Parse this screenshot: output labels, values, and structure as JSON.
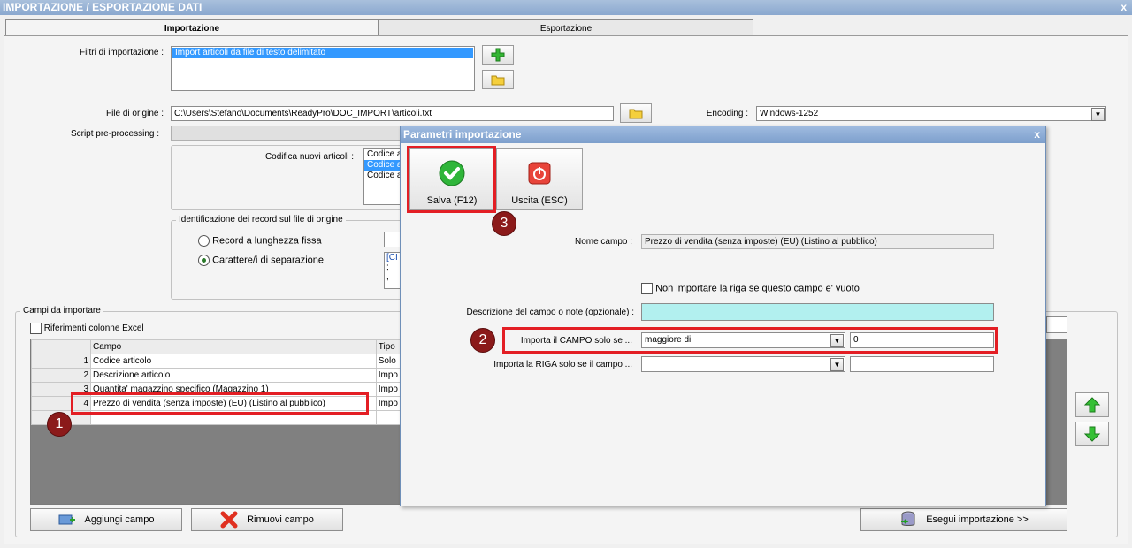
{
  "window": {
    "title": "IMPORTAZIONE / ESPORTAZIONE DATI",
    "close": "x"
  },
  "tabs": [
    {
      "label": "Importazione"
    },
    {
      "label": "Esportazione"
    }
  ],
  "filters": {
    "label": "Filtri di importazione :",
    "items": [
      "Import articoli da file di testo delimitato"
    ]
  },
  "origin": {
    "label": "File di origine :",
    "value": "C:\\Users\\Stefano\\Documents\\ReadyPro\\DOC_IMPORT\\articoli.txt"
  },
  "encoding": {
    "label": "Encoding :",
    "value": "Windows-1252"
  },
  "script": {
    "label": "Script pre-processing :"
  },
  "codifica": {
    "label": "Codifica nuovi articoli :",
    "items": [
      "Codice a",
      "Codice a",
      "Codice a"
    ]
  },
  "identificazione": {
    "title": "Identificazione dei record sul file di origine",
    "option1": "Record a lunghezza fissa",
    "option2": "Carattere/i di separazione",
    "sep_lines": [
      "[CI",
      ";",
      ","
    ]
  },
  "campi": {
    "title": "Campi da importare",
    "excel": "Riferimenti colonne Excel",
    "col_campo": "Campo",
    "col_tipo": "Tipo",
    "rows": [
      {
        "n": "1",
        "campo": "Codice articolo",
        "tipo": "Solo"
      },
      {
        "n": "2",
        "campo": "Descrizione articolo",
        "tipo": "Impo"
      },
      {
        "n": "3",
        "campo": "Quantita' magazzino specifico (Magazzino 1)",
        "tipo": "Impo"
      },
      {
        "n": "4",
        "campo": "Prezzo di vendita (senza imposte) (EU) (Listino al pubblico)",
        "tipo": "Impo"
      }
    ]
  },
  "buttons": {
    "add": "Aggiungi campo",
    "remove": "Rimuovi campo",
    "run": "Esegui importazione >>"
  },
  "dialog": {
    "title": "Parametri importazione",
    "close": "x",
    "save": "Salva (F12)",
    "exit": "Uscita (ESC)",
    "nome_label": "Nome campo :",
    "nome_value": "Prezzo di vendita (senza imposte) (EU) (Listino al pubblico)",
    "non_importare": "Non importare la riga se questo campo e' vuoto",
    "descr_label": "Descrizione del campo o note (opzionale) :",
    "campo_label": "Importa il CAMPO solo se ...",
    "campo_op": "maggiore di",
    "campo_val": "0",
    "riga_label": "Importa la RIGA solo se il campo ..."
  },
  "badges": {
    "b1": "1",
    "b2": "2",
    "b3": "3"
  },
  "colors": {
    "highlight": "#e31e24",
    "badge": "#8b1a1a",
    "selection": "#3399ff",
    "desc_field": "#b2f0ef"
  }
}
